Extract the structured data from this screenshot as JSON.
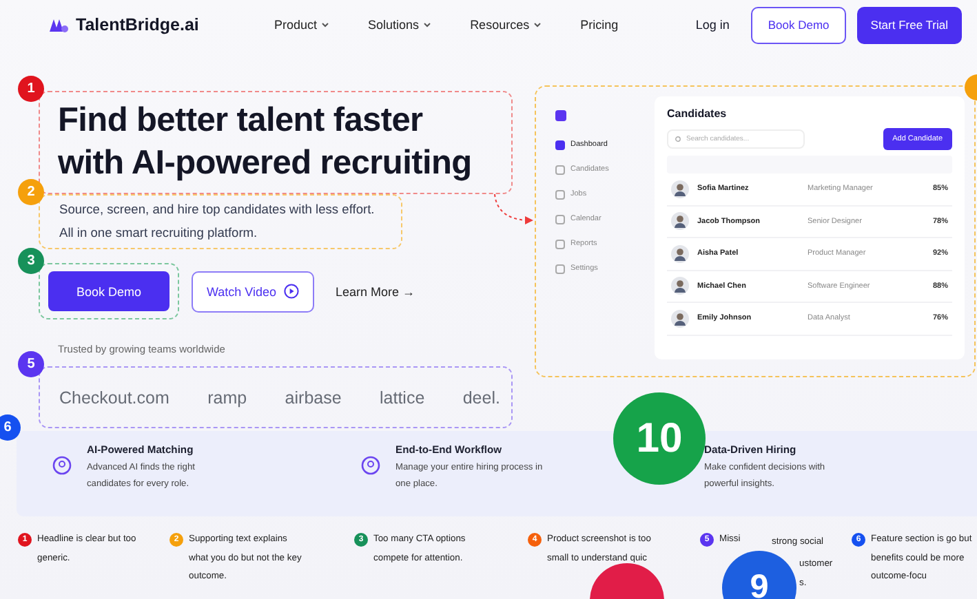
{
  "nav": {
    "logo": "TalentBridge.ai",
    "items": [
      {
        "label": "Product",
        "dropdown": true
      },
      {
        "label": "Solutions",
        "dropdown": true
      },
      {
        "label": "Resources",
        "dropdown": true
      },
      {
        "label": "Pricing",
        "dropdown": false
      }
    ],
    "login": "Log in",
    "book_demo": "Book Demo",
    "trial": "Start Free Trial"
  },
  "hero": {
    "headline_lines": [
      "Find better talent faster",
      "with AI-powered recruiting"
    ],
    "headline_marker": {
      "number": "1",
      "color": "#e0141e"
    },
    "subtext_lines": [
      "Source, screen, and hire top candidates with less effort.",
      "All in one smart recruiting platform."
    ],
    "subtext_marker": {
      "number": "2",
      "color": "#f5a00c"
    },
    "cta_marker": {
      "number": "3",
      "color": "#17915a"
    },
    "primary_cta": "Book Demo",
    "video_cta": "Watch Video",
    "learn_more": "Learn More →",
    "trusted": "Trusted by growing teams worldwide",
    "logos_marker": {
      "number": "5",
      "color": "#5b35f0"
    },
    "logos": [
      "Checkout.com",
      "ramp",
      "airbase",
      "lattice",
      "deel."
    ]
  },
  "app": {
    "marker": {
      "color": "#f5a00c"
    },
    "nav": [
      {
        "label": "Dashboard",
        "selected": true
      },
      {
        "label": "Candidates",
        "selected": false
      },
      {
        "label": "Jobs",
        "selected": false
      },
      {
        "label": "Calendar",
        "selected": false
      },
      {
        "label": "Reports",
        "selected": false
      },
      {
        "label": "Settings",
        "selected": false
      }
    ],
    "title": "Candidates",
    "search_placeholder": "Search candidates...",
    "add_button": "Add Candidate",
    "rows": [
      {
        "name": "Sofia Martinez",
        "role": "Marketing Manager",
        "score": "85%"
      },
      {
        "name": "Jacob Thompson",
        "role": "Senior Designer",
        "score": "78%"
      },
      {
        "name": "Aisha Patel",
        "role": "Product Manager",
        "score": "92%"
      },
      {
        "name": "Michael Chen",
        "role": "Software Engineer",
        "score": "88%"
      },
      {
        "name": "Emily Johnson",
        "role": "Data Analyst",
        "score": "76%"
      }
    ]
  },
  "features": {
    "marker": {
      "number": "6",
      "color": "#1550f0"
    },
    "items": [
      {
        "title": "AI-Powered Matching",
        "text": "Advanced AI finds the right candidates for every role."
      },
      {
        "title": "End-to-End Workflow",
        "text": "Manage your entire hiring process in one place."
      },
      {
        "title": "Data-Driven Hiring",
        "text": "Make confident decisions with powerful insights."
      }
    ]
  },
  "notes": [
    {
      "number": "1",
      "color": "#e0141e",
      "text": "Headline is clear but too generic."
    },
    {
      "number": "2",
      "color": "#f5a00c",
      "text": "Supporting text explains what you do but not the key outcome."
    },
    {
      "number": "3",
      "color": "#17915a",
      "text": "Too many CTA options compete for attention."
    },
    {
      "number": "4",
      "color": "#f5600c",
      "text": "Product screenshot is too small to understand quic"
    },
    {
      "number": "5",
      "color": "#5b35f0",
      "text": "Missi"
    },
    {
      "number": "6",
      "color": "#1550f0",
      "text": "Feature section is go but benefits could be more outcome-focu"
    }
  ],
  "note5_fragments": [
    "strong social",
    "ustomer",
    "s."
  ],
  "big_markers": [
    {
      "number": "10",
      "color": "#16a34a"
    },
    {
      "number": "9",
      "color": "#1d5fe0"
    },
    {
      "color": "#e11d48"
    }
  ]
}
